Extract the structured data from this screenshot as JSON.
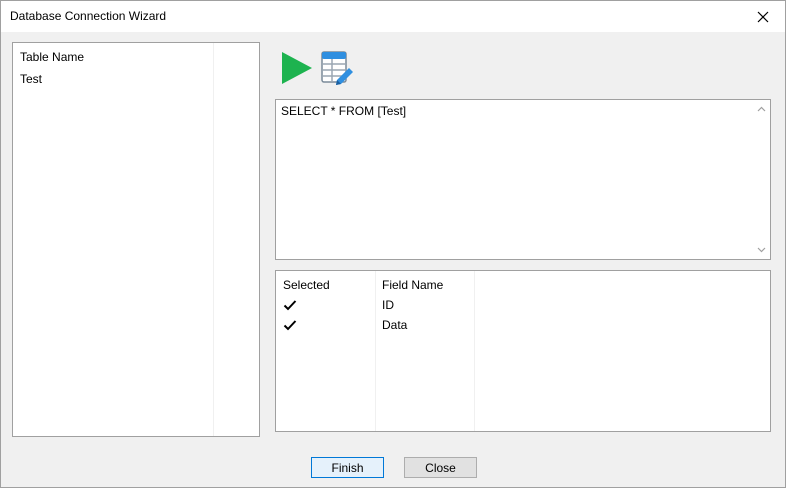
{
  "window": {
    "title": "Database Connection Wizard"
  },
  "table_list": {
    "header": "Table Name",
    "items": [
      "Test"
    ]
  },
  "toolbar": {
    "run_icon": "play-icon",
    "design_icon": "table-edit-icon"
  },
  "sql": {
    "query": "SELECT * FROM [Test]"
  },
  "fields": {
    "columns": [
      "Selected",
      "Field Name"
    ],
    "rows": [
      {
        "selected": true,
        "name": "ID"
      },
      {
        "selected": true,
        "name": "Data"
      }
    ]
  },
  "buttons": {
    "finish": "Finish",
    "close": "Close"
  },
  "colors": {
    "run_green": "#1db34f",
    "accent_blue": "#0078d7"
  }
}
